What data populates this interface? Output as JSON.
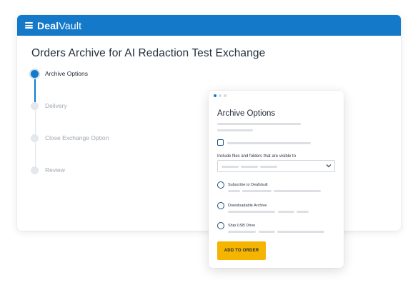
{
  "app": {
    "brand_bold": "Deal",
    "brand_regular": "Vault"
  },
  "page": {
    "title": "Orders Archive for AI Redaction Test Exchange"
  },
  "stepper": {
    "steps": [
      {
        "label": "Archive Options",
        "active": true
      },
      {
        "label": "Delivery",
        "active": false
      },
      {
        "label": "Close Exchange Option",
        "active": false
      },
      {
        "label": "Review",
        "active": false
      }
    ]
  },
  "panel": {
    "title": "Archive Options",
    "pager_active_index": 0,
    "include_files_label": "Include files and folders that are visible to",
    "options": [
      {
        "label": "Subscribe to DealVault"
      },
      {
        "label": "Downloadable Archive"
      },
      {
        "label": "Ship USB Drive"
      }
    ],
    "add_button_label": "ADD TO ORDER"
  },
  "colors": {
    "brand_blue": "#1479c9",
    "cta_yellow": "#f5b400"
  }
}
